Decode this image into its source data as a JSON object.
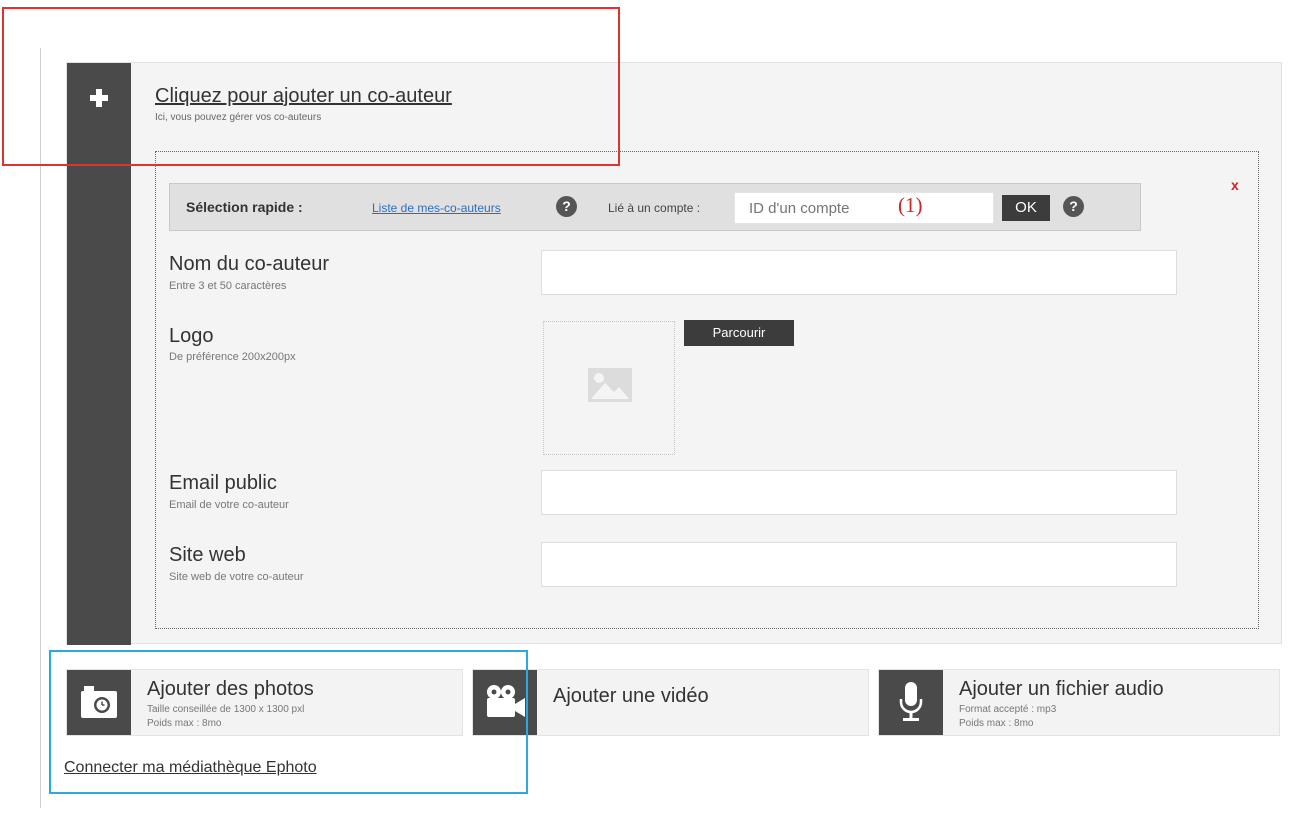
{
  "coauthor": {
    "add_link": "Cliquez pour ajouter un co-auteur",
    "add_subtitle": "Ici, vous pouvez gérer vos co-auteurs",
    "close_label": "x"
  },
  "quick_select": {
    "label": "Sélection rapide :",
    "list_link": "Liste de mes-co-auteurs",
    "help_symbol": "?",
    "linked_label": "Lié à un compte :",
    "account_placeholder": "ID d'un compte",
    "ok_label": "OK"
  },
  "annotation_marker": "(1)",
  "fields": {
    "name": {
      "label": "Nom du co-auteur",
      "hint": "Entre 3 et 50 caractères"
    },
    "logo": {
      "label": "Logo",
      "hint": "De préférence 200x200px",
      "browse_label": "Parcourir"
    },
    "email": {
      "label": "Email public",
      "hint": "Email de votre co-auteur"
    },
    "website": {
      "label": "Site web",
      "hint": "Site web de votre co-auteur"
    }
  },
  "media": {
    "photos": {
      "title": "Ajouter des photos",
      "line1": "Taille conseillée de 1300 x 1300 pxl",
      "line2": "Poids max : 8mo",
      "icon": "camera-icon"
    },
    "video": {
      "title": "Ajouter une vidéo",
      "icon": "video-camera-icon"
    },
    "audio": {
      "title": "Ajouter un fichier audio",
      "line1": "Format accepté : mp3",
      "line2": "Poids max : 8mo",
      "icon": "microphone-icon"
    }
  },
  "ephoto_link": "Connecter ma médiathèque Ephoto",
  "colors": {
    "dark_bar": "#4a4a4a",
    "panel_bg": "#f4f4f4",
    "link_blue": "#2a6fbf",
    "annotation_red": "#dd3333",
    "annotation_blue": "#2aa9e0",
    "close_red": "#d21f1f"
  }
}
